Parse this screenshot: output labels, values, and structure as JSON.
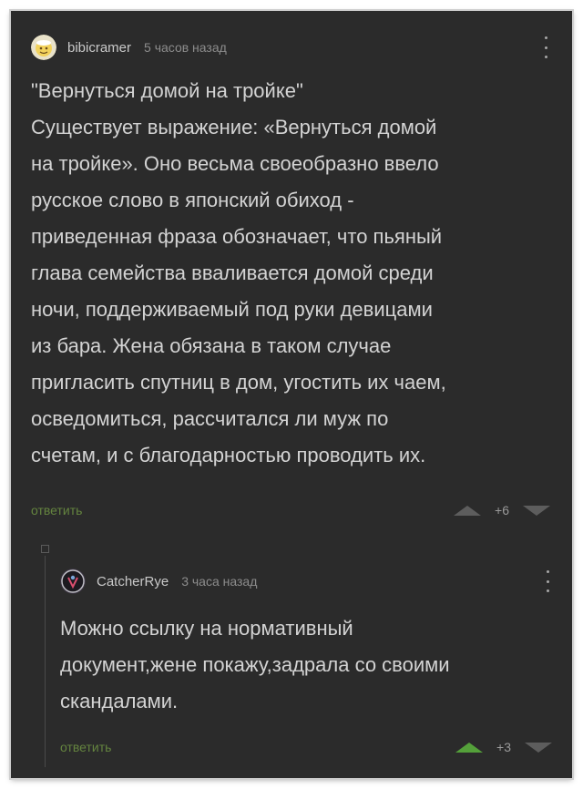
{
  "comments": [
    {
      "username": "bibicramer",
      "time": "5 часов назад",
      "text": "\"Вернуться домой на тройке\"\nСуществует выражение: «Вернуться домой\nна тройке». Оно весьма своеобразно ввело\nрусское слово в японский обиход -\nприведенная фраза обозначает, что пьяный\nглава семейства вваливается домой среди\nночи, поддерживаемый под руки девицами\nиз бара. Жена обязана в таком случае\nпригласить спутниц в дом, угостить их чаем,\nосведомиться, рассчитался ли муж по\nсчетам, и с благодарностью проводить их.",
      "reply_label": "ответить",
      "score": "+6"
    },
    {
      "username": "CatcherRye",
      "time": "3 часа назад",
      "text": "Можно ссылку на нормативный\nдокумент,жене покажу,задрала со своими\nскандалами.",
      "reply_label": "ответить",
      "score": "+3"
    }
  ],
  "colors": {
    "background": "#2b2b2b",
    "text": "#d3d3d3",
    "reply": "#64843f",
    "upvote_active": "#54a03a"
  }
}
